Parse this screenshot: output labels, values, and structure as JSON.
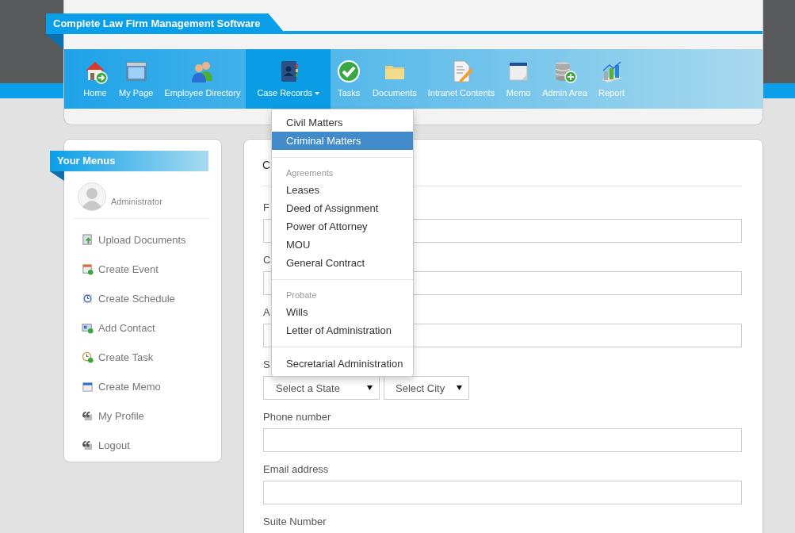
{
  "header": {
    "title": "Complete Law Firm Management Software"
  },
  "nav": [
    {
      "label": "Home",
      "selected": false,
      "has_caret": false
    },
    {
      "label": "My Page",
      "selected": false,
      "has_caret": false
    },
    {
      "label": "Employee Directory",
      "selected": false,
      "has_caret": false
    },
    {
      "label": "Case Records",
      "selected": true,
      "has_caret": true
    },
    {
      "label": "Tasks",
      "selected": false,
      "has_caret": false
    },
    {
      "label": "Documents",
      "selected": false,
      "has_caret": false
    },
    {
      "label": "Intranet Contents",
      "selected": false,
      "has_caret": false
    },
    {
      "label": "Memo",
      "selected": false,
      "has_caret": false
    },
    {
      "label": "Admin Area",
      "selected": false,
      "has_caret": false
    },
    {
      "label": "Report",
      "selected": false,
      "has_caret": false
    }
  ],
  "dropdown": {
    "sections": [
      {
        "items": [
          {
            "label": "Civil Matters",
            "selected": false
          },
          {
            "label": "Criminal Matters",
            "selected": true
          }
        ]
      },
      {
        "header": "Agreements",
        "items": [
          {
            "label": "Leases",
            "selected": false
          },
          {
            "label": "Deed of Assignment",
            "selected": false
          },
          {
            "label": "Power of Attorney",
            "selected": false
          },
          {
            "label": "MOU",
            "selected": false
          },
          {
            "label": "General Contract",
            "selected": false
          }
        ]
      },
      {
        "header": "Probate",
        "items": [
          {
            "label": "Wills",
            "selected": false
          },
          {
            "label": "Letter of Administration",
            "selected": false
          }
        ]
      },
      {
        "items": [
          {
            "label": "Secretarial Administration",
            "selected": false
          }
        ]
      }
    ]
  },
  "sidebar": {
    "title": "Your Menus",
    "user": "Administrator",
    "items": [
      "Upload Documents",
      "Create Event",
      "Create Schedule",
      "Add Contact",
      "Create Task",
      "Create Memo",
      "My Profile",
      "Logout"
    ]
  },
  "form": {
    "heading": "C",
    "fields": [
      {
        "kind": "input",
        "label": "F"
      },
      {
        "kind": "input",
        "label": "C"
      },
      {
        "kind": "input",
        "label": "A"
      },
      {
        "kind": "selects",
        "label": "S",
        "selects": [
          "Select a State",
          "Select City"
        ]
      },
      {
        "kind": "input",
        "label": "Phone number"
      },
      {
        "kind": "input",
        "label": "Email address"
      },
      {
        "kind": "label",
        "label": "Suite Number"
      }
    ]
  }
}
